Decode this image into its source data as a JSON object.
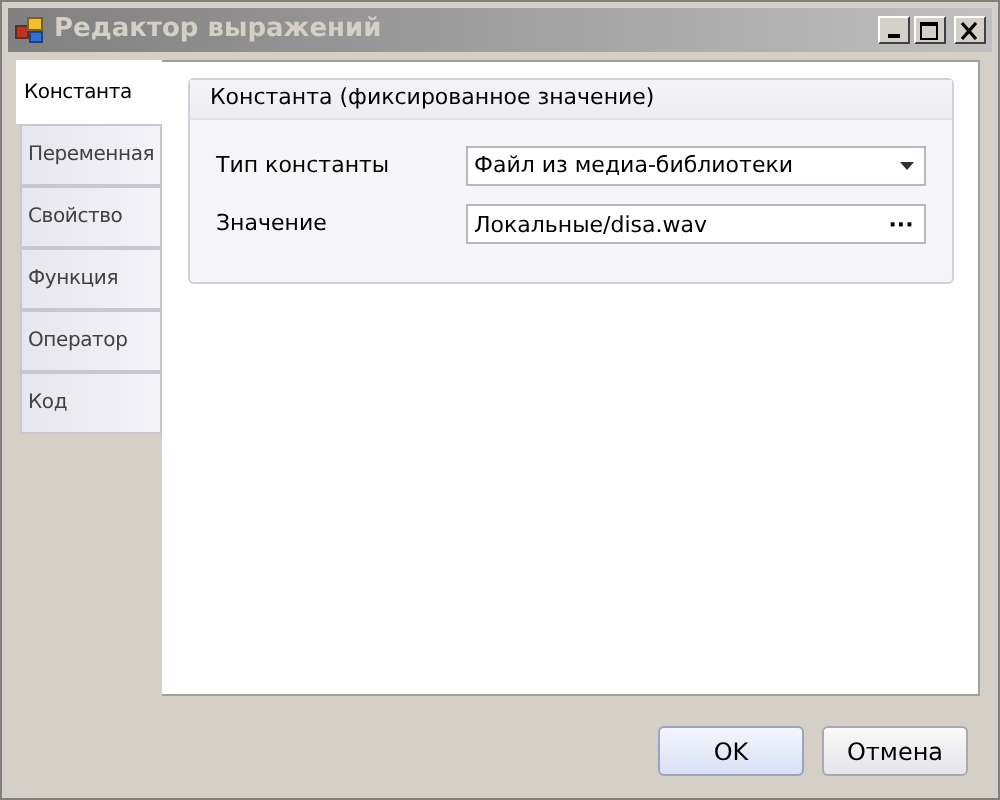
{
  "window": {
    "title": "Редактор выражений",
    "active": false
  },
  "tabs": [
    {
      "label": "Константа",
      "selected": true
    },
    {
      "label": "Переменная",
      "selected": false
    },
    {
      "label": "Свойство",
      "selected": false
    },
    {
      "label": "Функция",
      "selected": false
    },
    {
      "label": "Оператор",
      "selected": false
    },
    {
      "label": "Код",
      "selected": false
    }
  ],
  "group": {
    "title": "Константа (фиксированное значение)",
    "fields": [
      {
        "kind": "dropdown",
        "label": "Тип константы",
        "value": "Файл из медиа-библиотеки"
      },
      {
        "kind": "browse",
        "label": "Значение",
        "value": "Локальные/disa.wav",
        "button": "···"
      }
    ]
  },
  "buttons": [
    {
      "label": "OK",
      "default": true
    },
    {
      "label": "Отмена",
      "default": false
    }
  ]
}
